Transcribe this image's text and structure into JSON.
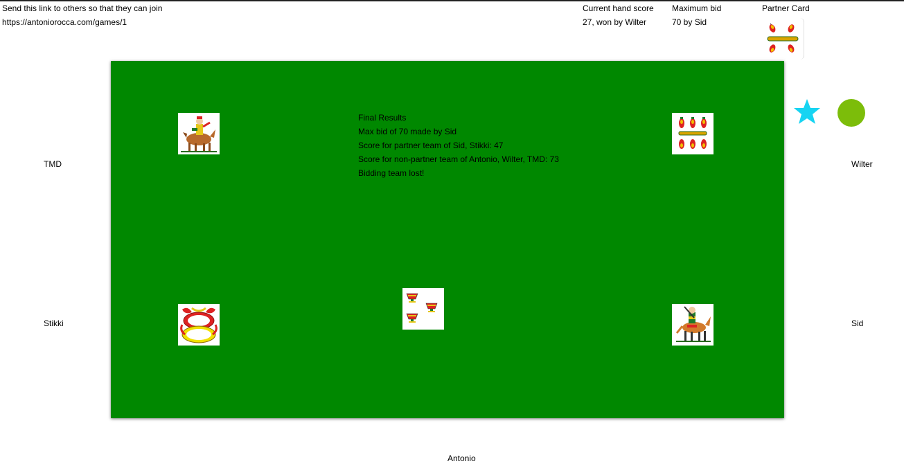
{
  "share": {
    "label": "Send this link to others so that they can join",
    "link": "https://antoniorocca.com/games/1"
  },
  "hand_score": {
    "label": "Current hand score",
    "value": "27, won by Wilter"
  },
  "max_bid": {
    "label": "Maximum bid",
    "value": "70 by Sid"
  },
  "partner_card": {
    "label": "Partner Card",
    "card": "four-of-batons-card"
  },
  "results": {
    "title": "Final Results",
    "line1": "Max bid of 70 made by Sid",
    "line2": "Score for partner team of Sid, Stikki: 47",
    "line3": "Score for non-partner team of Antonio, Wilter, TMD: 73",
    "line4": "Bidding team lost!"
  },
  "players": {
    "top_left": "TMD",
    "top_right": "Wilter",
    "bottom_left": "Stikki",
    "bottom_right": "Sid",
    "bottom": "Antonio"
  },
  "table_cards": {
    "tmd": "knight-card",
    "wilter": "six-of-batons-card",
    "stikki": "ace-of-coins-card",
    "sid": "knight-card",
    "antonio": "three-of-cups-card"
  },
  "indicators": {
    "star_color": "#16d4f2",
    "circle_color": "#7cbd0a"
  },
  "colors": {
    "table": "#008800"
  }
}
